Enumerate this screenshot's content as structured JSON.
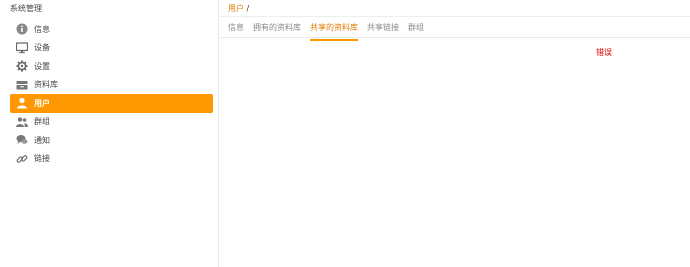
{
  "sidebar": {
    "title": "系统管理",
    "items": [
      {
        "label": "信息",
        "icon": "info-icon"
      },
      {
        "label": "设备",
        "icon": "monitor-icon"
      },
      {
        "label": "设置",
        "icon": "gear-icon"
      },
      {
        "label": "资料库",
        "icon": "library-icon"
      },
      {
        "label": "用户",
        "icon": "user-icon",
        "active": true
      },
      {
        "label": "群组",
        "icon": "group-icon"
      },
      {
        "label": "通知",
        "icon": "notification-icon"
      },
      {
        "label": "链接",
        "icon": "link-icon"
      }
    ]
  },
  "breadcrumb": {
    "link": "用户",
    "separator": "/"
  },
  "tabs": [
    {
      "label": "信息"
    },
    {
      "label": "拥有的资料库"
    },
    {
      "label": "共享的资料库",
      "active": true
    },
    {
      "label": "共享链接"
    },
    {
      "label": "群组"
    }
  ],
  "content": {
    "error": "错误"
  },
  "colors": {
    "accent": "#ff9800",
    "accent_text": "#e07b00",
    "error": "#e00000"
  }
}
